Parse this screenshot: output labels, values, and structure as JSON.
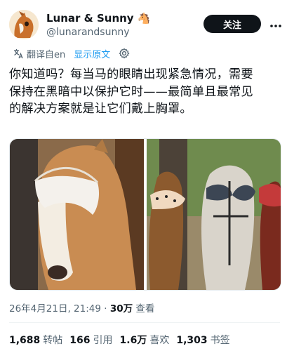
{
  "author": {
    "display_name": "Lunar & Sunny 🐴",
    "handle": "@lunarandsunny"
  },
  "header": {
    "follow_label": "关注",
    "more_icon": "more-horizontal-icon"
  },
  "translate": {
    "label": "翻译自en",
    "show_original": "显示原文",
    "icon": "translate-icon",
    "settings_icon": "gear-icon"
  },
  "tweet": {
    "lines": [
      "你知道吗？每当马的眼睛出现紧急情况，需要",
      "保持在黑暗中以保护它时——最简单且最常见",
      "的解决方案就是让它们戴上胸罩。"
    ]
  },
  "meta": {
    "timestamp": "26年4月21日, 21:49",
    "separator": "·",
    "views": "30万",
    "views_label": "查看"
  },
  "stats": [
    {
      "count": "1,688",
      "label": "转帖"
    },
    {
      "count": "166",
      "label": "引用"
    },
    {
      "count": "1.6万",
      "label": "喜欢"
    },
    {
      "count": "1,303",
      "label": "书签"
    }
  ],
  "colors": {
    "accent": "#1d9bf0",
    "text": "#0f1419",
    "muted": "#536471",
    "button": "#0f1419"
  }
}
